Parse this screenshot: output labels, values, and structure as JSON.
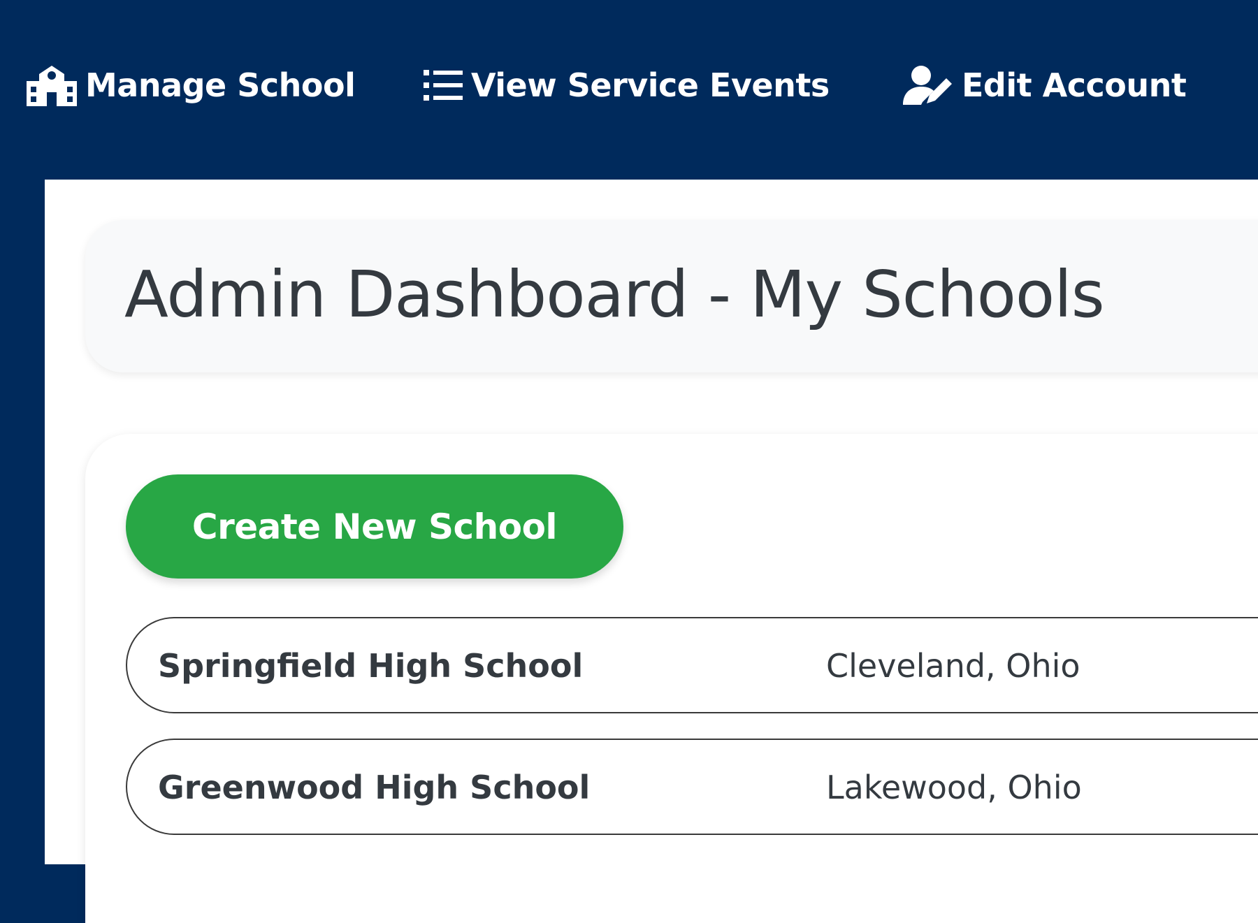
{
  "nav": {
    "items": [
      {
        "label": "Manage School",
        "icon": "school-icon"
      },
      {
        "label": "View Service Events",
        "icon": "list-icon"
      },
      {
        "label": "Edit Account",
        "icon": "user-edit-icon"
      }
    ]
  },
  "header": {
    "title": "Admin Dashboard - My Schools"
  },
  "actions": {
    "create_label": "Create New School"
  },
  "schools": [
    {
      "name": "Springfield High School",
      "location": "Cleveland, Ohio"
    },
    {
      "name": "Greenwood High School",
      "location": "Lakewood, Ohio"
    }
  ],
  "colors": {
    "nav_background": "#002a5c",
    "primary_button": "#28a745",
    "title_text": "#343a40",
    "header_card": "#f8f9fa"
  }
}
